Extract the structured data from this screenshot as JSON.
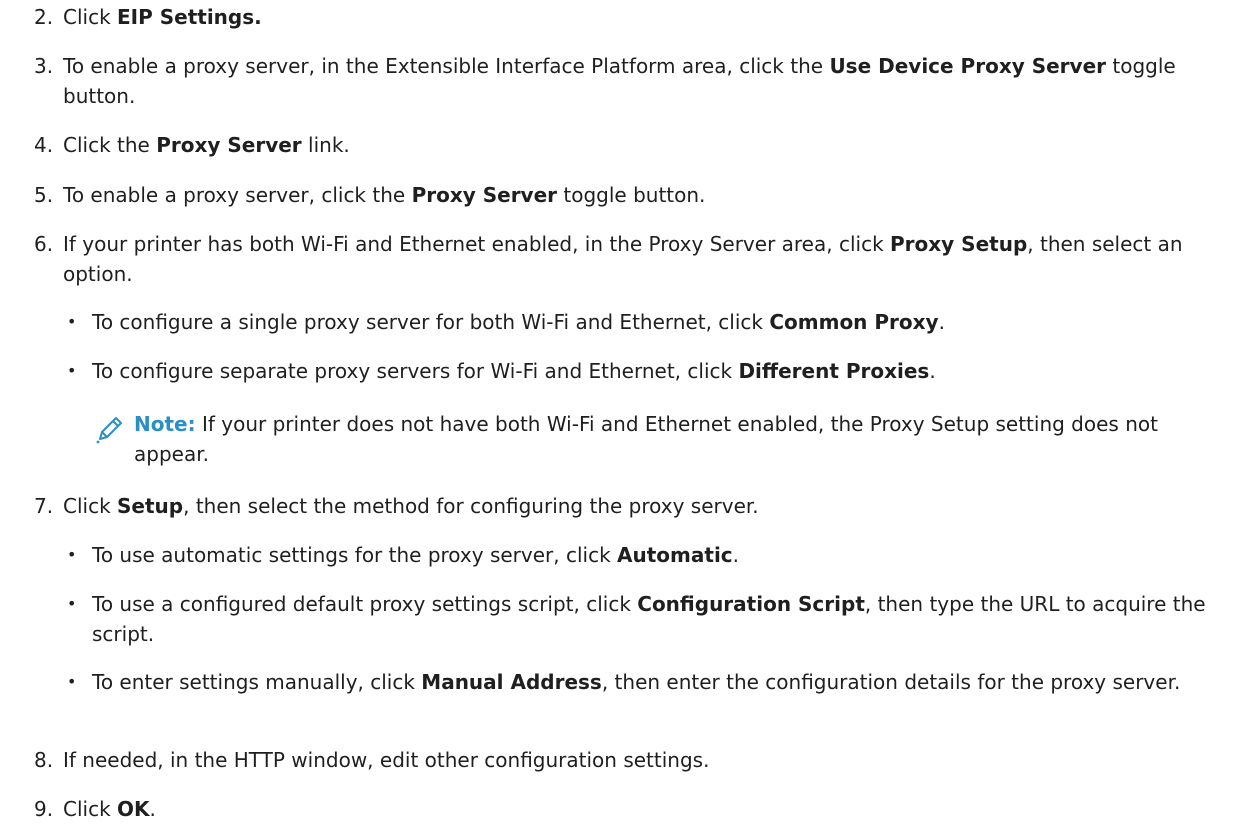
{
  "steps": [
    {
      "num": "2.",
      "parts": [
        {
          "t": "Click "
        },
        {
          "b": "EIP Settings."
        }
      ]
    },
    {
      "num": "3.",
      "parts": [
        {
          "t": "To enable a proxy server, in the Extensible Interface Platform area, click the "
        },
        {
          "b": "Use Device Proxy Server"
        },
        {
          "t": " toggle button."
        }
      ]
    },
    {
      "num": "4.",
      "parts": [
        {
          "t": "Click the "
        },
        {
          "b": "Proxy Server"
        },
        {
          "t": " link."
        }
      ]
    },
    {
      "num": "5.",
      "parts": [
        {
          "t": "To enable a proxy server, click the "
        },
        {
          "b": "Proxy Server"
        },
        {
          "t": " toggle button."
        }
      ]
    },
    {
      "num": "6.",
      "parts": [
        {
          "t": "If your printer has both Wi-Fi and Ethernet enabled, in the Proxy Server area, click "
        },
        {
          "b": "Proxy Setup"
        },
        {
          "t": ", then select an option."
        }
      ]
    },
    {
      "num": "7.",
      "parts": [
        {
          "t": "Click "
        },
        {
          "b": "Setup"
        },
        {
          "t": ", then select the method for configuring the proxy server."
        }
      ]
    },
    {
      "num": "8.",
      "parts": [
        {
          "t": "If needed, in the HTTP window, edit other configuration settings."
        }
      ]
    },
    {
      "num": "9.",
      "parts": [
        {
          "t": "Click "
        },
        {
          "b": "OK"
        },
        {
          "t": "."
        }
      ]
    }
  ],
  "step6_bullets": [
    {
      "parts": [
        {
          "t": "To configure a single proxy server for both Wi-Fi and Ethernet, click "
        },
        {
          "b": "Common Proxy"
        },
        {
          "t": "."
        }
      ]
    },
    {
      "parts": [
        {
          "t": "To configure separate proxy servers for Wi-Fi and Ethernet, click "
        },
        {
          "b": "Different Proxies"
        },
        {
          "t": "."
        }
      ]
    }
  ],
  "note": {
    "label": "Note:",
    "text": " If your printer does not have both Wi-Fi and Ethernet enabled, the Proxy Setup setting does not appear.",
    "icon": "pencil-icon",
    "label_color": "#2a8fc7"
  },
  "step7_bullets": [
    {
      "parts": [
        {
          "t": "To use automatic settings for the proxy server, click "
        },
        {
          "b": "Automatic"
        },
        {
          "t": "."
        }
      ]
    },
    {
      "parts": [
        {
          "t": "To use a configured default proxy settings script, click "
        },
        {
          "b": "Configuration Script"
        },
        {
          "t": ", then type the URL to acquire the script."
        }
      ]
    },
    {
      "parts": [
        {
          "t": "To enter settings manually, click "
        },
        {
          "b": "Manual Address"
        },
        {
          "t": ", then enter the configuration details for the proxy server."
        }
      ]
    }
  ],
  "bullet_glyph": "•"
}
